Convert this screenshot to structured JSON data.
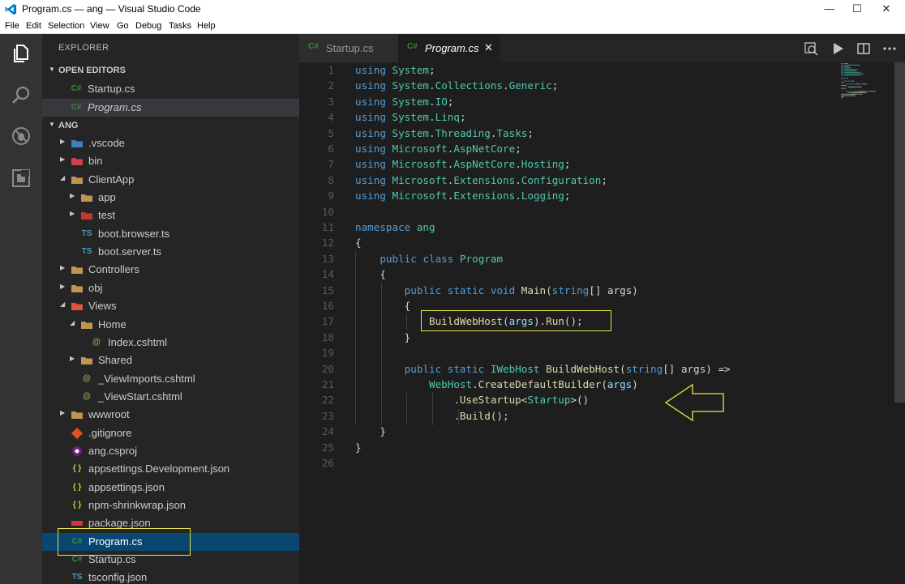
{
  "window": {
    "title": "Program.cs — ang — Visual Studio Code",
    "minimize": "—",
    "maximize": "☐",
    "close": "✕"
  },
  "menu": [
    "File",
    "Edit",
    "Selection",
    "View",
    "Go",
    "Debug",
    "Tasks",
    "Help"
  ],
  "sidebar": {
    "title": "EXPLORER",
    "open_editors_label": "OPEN EDITORS",
    "open_editors": [
      {
        "name": "Startup.cs",
        "icon": "csharp-icon",
        "italic": false
      },
      {
        "name": "Program.cs",
        "icon": "csharp-icon",
        "italic": true
      }
    ],
    "project_label": "ANG",
    "tree": [
      {
        "name": ".vscode",
        "depth": 0,
        "kind": "folder",
        "icon": "vscode-folder-icon",
        "expanded": false
      },
      {
        "name": "bin",
        "depth": 0,
        "kind": "folder",
        "icon": "bin-folder-icon",
        "expanded": false
      },
      {
        "name": "ClientApp",
        "depth": 0,
        "kind": "folder",
        "icon": "folder-open-icon",
        "expanded": true
      },
      {
        "name": "app",
        "depth": 1,
        "kind": "folder",
        "icon": "folder-icon",
        "expanded": false
      },
      {
        "name": "test",
        "depth": 1,
        "kind": "folder",
        "icon": "test-folder-icon",
        "expanded": false
      },
      {
        "name": "boot.browser.ts",
        "depth": 1,
        "kind": "file",
        "icon": "typescript-icon"
      },
      {
        "name": "boot.server.ts",
        "depth": 1,
        "kind": "file",
        "icon": "typescript-icon"
      },
      {
        "name": "Controllers",
        "depth": 0,
        "kind": "folder",
        "icon": "folder-icon",
        "expanded": false
      },
      {
        "name": "obj",
        "depth": 0,
        "kind": "folder",
        "icon": "folder-icon",
        "expanded": false
      },
      {
        "name": "Views",
        "depth": 0,
        "kind": "folder",
        "icon": "views-folder-icon",
        "expanded": true
      },
      {
        "name": "Home",
        "depth": 1,
        "kind": "folder",
        "icon": "folder-open-icon",
        "expanded": true
      },
      {
        "name": "Index.cshtml",
        "depth": 2,
        "kind": "file",
        "icon": "razor-icon"
      },
      {
        "name": "Shared",
        "depth": 1,
        "kind": "folder",
        "icon": "folder-icon",
        "expanded": false
      },
      {
        "name": "_ViewImports.cshtml",
        "depth": 1,
        "kind": "file",
        "icon": "razor-icon"
      },
      {
        "name": "_ViewStart.cshtml",
        "depth": 1,
        "kind": "file",
        "icon": "razor-icon"
      },
      {
        "name": "wwwroot",
        "depth": 0,
        "kind": "folder",
        "icon": "folder-icon",
        "expanded": false
      },
      {
        "name": ".gitignore",
        "depth": 0,
        "kind": "file",
        "icon": "git-icon"
      },
      {
        "name": "ang.csproj",
        "depth": 0,
        "kind": "file",
        "icon": "csproj-icon"
      },
      {
        "name": "appsettings.Development.json",
        "depth": 0,
        "kind": "file",
        "icon": "json-icon"
      },
      {
        "name": "appsettings.json",
        "depth": 0,
        "kind": "file",
        "icon": "json-icon"
      },
      {
        "name": "npm-shrinkwrap.json",
        "depth": 0,
        "kind": "file",
        "icon": "json-icon"
      },
      {
        "name": "package.json",
        "depth": 0,
        "kind": "file",
        "icon": "npm-icon"
      },
      {
        "name": "Program.cs",
        "depth": 0,
        "kind": "file",
        "icon": "csharp-icon",
        "selected": true
      },
      {
        "name": "Startup.cs",
        "depth": 0,
        "kind": "file",
        "icon": "csharp-icon"
      },
      {
        "name": "tsconfig.json",
        "depth": 0,
        "kind": "file",
        "icon": "typescript-icon"
      }
    ]
  },
  "tabs": [
    {
      "label": "Startup.cs",
      "icon": "csharp-icon",
      "active": false
    },
    {
      "label": "Program.cs",
      "icon": "csharp-icon",
      "active": true,
      "close": "✕"
    }
  ],
  "editor": {
    "lines": [
      [
        [
          "kw",
          "using"
        ],
        [
          "pl",
          " "
        ],
        [
          "ty",
          "System"
        ],
        [
          "pl",
          ";"
        ]
      ],
      [
        [
          "kw",
          "using"
        ],
        [
          "pl",
          " "
        ],
        [
          "ty",
          "System"
        ],
        [
          "pl",
          "."
        ],
        [
          "ty",
          "Collections"
        ],
        [
          "pl",
          "."
        ],
        [
          "ty",
          "Generic"
        ],
        [
          "pl",
          ";"
        ]
      ],
      [
        [
          "kw",
          "using"
        ],
        [
          "pl",
          " "
        ],
        [
          "ty",
          "System"
        ],
        [
          "pl",
          "."
        ],
        [
          "ty",
          "IO"
        ],
        [
          "pl",
          ";"
        ]
      ],
      [
        [
          "kw",
          "using"
        ],
        [
          "pl",
          " "
        ],
        [
          "ty",
          "System"
        ],
        [
          "pl",
          "."
        ],
        [
          "ty",
          "Linq"
        ],
        [
          "pl",
          ";"
        ]
      ],
      [
        [
          "kw",
          "using"
        ],
        [
          "pl",
          " "
        ],
        [
          "ty",
          "System"
        ],
        [
          "pl",
          "."
        ],
        [
          "ty",
          "Threading"
        ],
        [
          "pl",
          "."
        ],
        [
          "ty",
          "Tasks"
        ],
        [
          "pl",
          ";"
        ]
      ],
      [
        [
          "kw",
          "using"
        ],
        [
          "pl",
          " "
        ],
        [
          "ty",
          "Microsoft"
        ],
        [
          "pl",
          "."
        ],
        [
          "ty",
          "AspNetCore"
        ],
        [
          "pl",
          ";"
        ]
      ],
      [
        [
          "kw",
          "using"
        ],
        [
          "pl",
          " "
        ],
        [
          "ty",
          "Microsoft"
        ],
        [
          "pl",
          "."
        ],
        [
          "ty",
          "AspNetCore"
        ],
        [
          "pl",
          "."
        ],
        [
          "ty",
          "Hosting"
        ],
        [
          "pl",
          ";"
        ]
      ],
      [
        [
          "kw",
          "using"
        ],
        [
          "pl",
          " "
        ],
        [
          "ty",
          "Microsoft"
        ],
        [
          "pl",
          "."
        ],
        [
          "ty",
          "Extensions"
        ],
        [
          "pl",
          "."
        ],
        [
          "ty",
          "Configuration"
        ],
        [
          "pl",
          ";"
        ]
      ],
      [
        [
          "kw",
          "using"
        ],
        [
          "pl",
          " "
        ],
        [
          "ty",
          "Microsoft"
        ],
        [
          "pl",
          "."
        ],
        [
          "ty",
          "Extensions"
        ],
        [
          "pl",
          "."
        ],
        [
          "ty",
          "Logging"
        ],
        [
          "pl",
          ";"
        ]
      ],
      [],
      [
        [
          "kw",
          "namespace"
        ],
        [
          "pl",
          " "
        ],
        [
          "ty",
          "ang"
        ]
      ],
      [
        [
          "pl",
          "{"
        ]
      ],
      [
        [
          "pl",
          "    "
        ],
        [
          "kw",
          "public"
        ],
        [
          "pl",
          " "
        ],
        [
          "kw",
          "class"
        ],
        [
          "pl",
          " "
        ],
        [
          "ty",
          "Program"
        ]
      ],
      [
        [
          "pl",
          "    {"
        ]
      ],
      [
        [
          "pl",
          "        "
        ],
        [
          "kw",
          "public"
        ],
        [
          "pl",
          " "
        ],
        [
          "kw",
          "static"
        ],
        [
          "pl",
          " "
        ],
        [
          "kw",
          "void"
        ],
        [
          "pl",
          " "
        ],
        [
          "fn",
          "Main"
        ],
        [
          "pl",
          "("
        ],
        [
          "kw",
          "string"
        ],
        [
          "pl",
          "[] args)"
        ]
      ],
      [
        [
          "pl",
          "        {"
        ]
      ],
      [
        [
          "pl",
          "            "
        ],
        [
          "fn",
          "BuildWebHost"
        ],
        [
          "pl",
          "("
        ],
        [
          "pa",
          "args"
        ],
        [
          "pl",
          ")."
        ],
        [
          "fn",
          "Run"
        ],
        [
          "pl",
          "();"
        ]
      ],
      [
        [
          "pl",
          "        }"
        ]
      ],
      [],
      [
        [
          "pl",
          "        "
        ],
        [
          "kw",
          "public"
        ],
        [
          "pl",
          " "
        ],
        [
          "kw",
          "static"
        ],
        [
          "pl",
          " "
        ],
        [
          "ty",
          "IWebHost"
        ],
        [
          "pl",
          " "
        ],
        [
          "fn",
          "BuildWebHost"
        ],
        [
          "pl",
          "("
        ],
        [
          "kw",
          "string"
        ],
        [
          "pl",
          "[] args) =>"
        ]
      ],
      [
        [
          "pl",
          "            "
        ],
        [
          "ty",
          "WebHost"
        ],
        [
          "pl",
          "."
        ],
        [
          "fn",
          "CreateDefaultBuilder"
        ],
        [
          "pl",
          "("
        ],
        [
          "pa",
          "args"
        ],
        [
          "pl",
          ")"
        ]
      ],
      [
        [
          "pl",
          "                ."
        ],
        [
          "fn",
          "UseStartup"
        ],
        [
          "pl",
          "<"
        ],
        [
          "ty",
          "Startup"
        ],
        [
          "pl",
          ">()"
        ]
      ],
      [
        [
          "pl",
          "                ."
        ],
        [
          "fn",
          "Build"
        ],
        [
          "pl",
          "();"
        ]
      ],
      [
        [
          "pl",
          "    }"
        ]
      ],
      [
        [
          "pl",
          "}"
        ]
      ],
      []
    ]
  },
  "colors": {
    "keyword": "#569cd6",
    "type": "#4ec9b0",
    "function": "#dcdcaa",
    "parameter": "#9cdcfe",
    "annotation": "#e8e84a",
    "selection": "#094771"
  }
}
